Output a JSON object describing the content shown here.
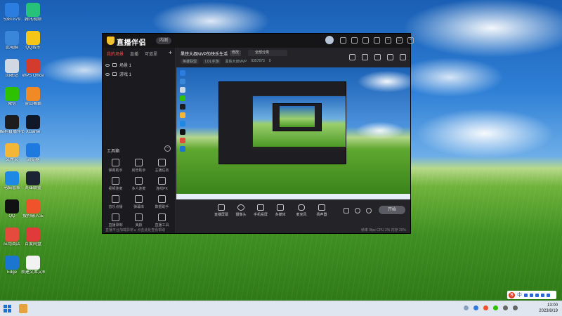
{
  "desktop": {
    "icons": [
      {
        "label": "538T879",
        "color": "#2b7de0"
      },
      {
        "label": "腾讯视频",
        "color": "#27c27a"
      },
      {
        "label": "此电脑",
        "color": "#3a86d8"
      },
      {
        "label": "QQ音乐",
        "color": "#f5c518"
      },
      {
        "label": "回收站",
        "color": "#cfd8e3"
      },
      {
        "label": "WPS Office",
        "color": "#d33b2c"
      },
      {
        "label": "微信",
        "color": "#2dc100"
      },
      {
        "label": "金山毒霸",
        "color": "#f08a24"
      },
      {
        "label": "酷狗直播伴侣",
        "color": "#1d1d1d"
      },
      {
        "label": "XGame",
        "color": "#111827"
      },
      {
        "label": "文件夹",
        "color": "#f4b637"
      },
      {
        "label": "浏览器",
        "color": "#1f7ae0"
      },
      {
        "label": "电脑管家",
        "color": "#1e88e5"
      },
      {
        "label": "英雄联盟",
        "color": "#1c2333"
      },
      {
        "label": "QQ",
        "color": "#111111"
      },
      {
        "label": "搜狗输入法",
        "color": "#f0532b"
      },
      {
        "label": "应用商店",
        "color": "#e44b3c"
      },
      {
        "label": "百度网盘",
        "color": "#e03a3a"
      },
      {
        "label": "Edge",
        "color": "#1b76d2"
      },
      {
        "label": "新建文本文档",
        "color": "#f2f2f2"
      }
    ]
  },
  "app": {
    "logo": "直播伴侣",
    "version": "内测",
    "sidebar": {
      "tabs": [
        "我的场景",
        "直播",
        "可道里"
      ],
      "add_label": "+",
      "scenes": [
        "场景 1",
        "游戏 1"
      ],
      "tools_title": "工具箱",
      "tools_toggle": "−",
      "tools": [
        {
          "label": "弹幕助手"
        },
        {
          "label": "房管助手"
        },
        {
          "label": "主播任务"
        },
        {
          "label": "视频连麦"
        },
        {
          "label": "多人连麦"
        },
        {
          "label": "连线PK"
        },
        {
          "label": "音乐点播"
        },
        {
          "label": "弹幕库"
        },
        {
          "label": "数据助手"
        },
        {
          "label": "直播录制"
        },
        {
          "label": "美颜"
        },
        {
          "label": "直播工具"
        }
      ],
      "footer": "直播平台加载异常 ▸ 点击此处查看帮助"
    },
    "main": {
      "title": "黑铁大叔MVP的快乐生活",
      "edit_label": "修改",
      "category": "全部分类",
      "tags": [
        "英雄联盟",
        "LOL手游",
        "黑铁大叔MVP",
        "9357873",
        "0"
      ],
      "controls": [
        {
          "label": "直播屏幕"
        },
        {
          "label": "摄像头"
        },
        {
          "label": "手机投屏"
        },
        {
          "label": "多媒体"
        },
        {
          "label": "麦克风"
        },
        {
          "label": "扬声器"
        }
      ],
      "go_live": "开始",
      "status": "帧率 0fps  CPU 2%  内存 20%"
    }
  },
  "taskbar": {
    "time": "13:00",
    "date": "2023/8/19",
    "ime_label": "S"
  }
}
